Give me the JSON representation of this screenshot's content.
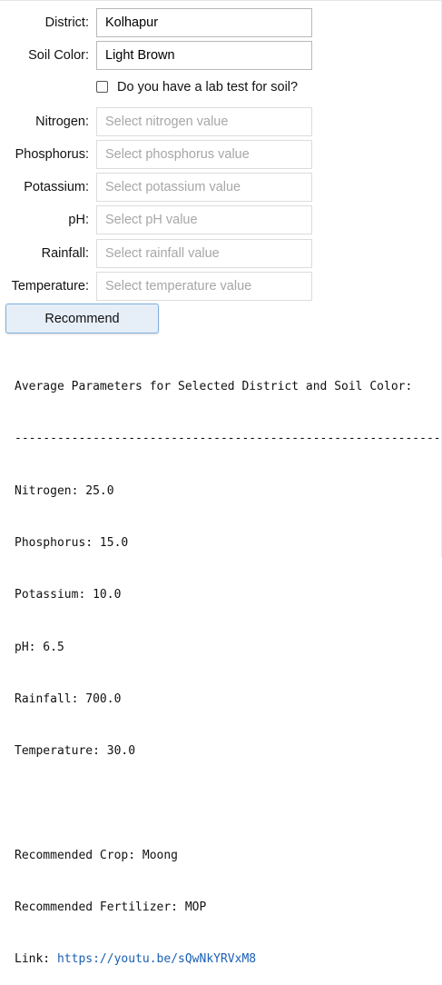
{
  "form": {
    "district": {
      "label": "District:",
      "value": "Kolhapur"
    },
    "soil_color": {
      "label": "Soil Color:",
      "value": "Light Brown"
    },
    "lab_test": {
      "label": "Do you have a lab test for soil?",
      "checked": false
    },
    "nitrogen": {
      "label": "Nitrogen:",
      "placeholder": "Select nitrogen value"
    },
    "phosphorus": {
      "label": "Phosphorus:",
      "placeholder": "Select phosphorus value"
    },
    "potassium": {
      "label": "Potassium:",
      "placeholder": "Select potassium value"
    },
    "ph": {
      "label": "pH:",
      "placeholder": "Select pH value"
    },
    "rainfall": {
      "label": "Rainfall:",
      "placeholder": "Select rainfall value"
    },
    "temperature": {
      "label": "Temperature:",
      "placeholder": "Select temperature value"
    },
    "recommend_button": "Recommend"
  },
  "output": {
    "heading": "Average Parameters for Selected District and Soil Color:",
    "separator": "------------------------------------------------------------",
    "nitrogen": "Nitrogen: 25.0",
    "phosphorus": "Phosphorus: 15.0",
    "potassium": "Potassium: 10.0",
    "ph": "pH: 6.5",
    "rainfall": "Rainfall: 700.0",
    "temperature": "Temperature: 30.0",
    "crop": "Recommended Crop: Moong",
    "fertilizer": "Recommended Fertilizer: MOP",
    "link_label": "Link: ",
    "link_url": "https://youtu.be/sQwNkYRVxM8"
  },
  "colors": {
    "button_bg": "#e6eef8",
    "button_border": "#7fb0dc",
    "link": "#1a5fb4"
  }
}
